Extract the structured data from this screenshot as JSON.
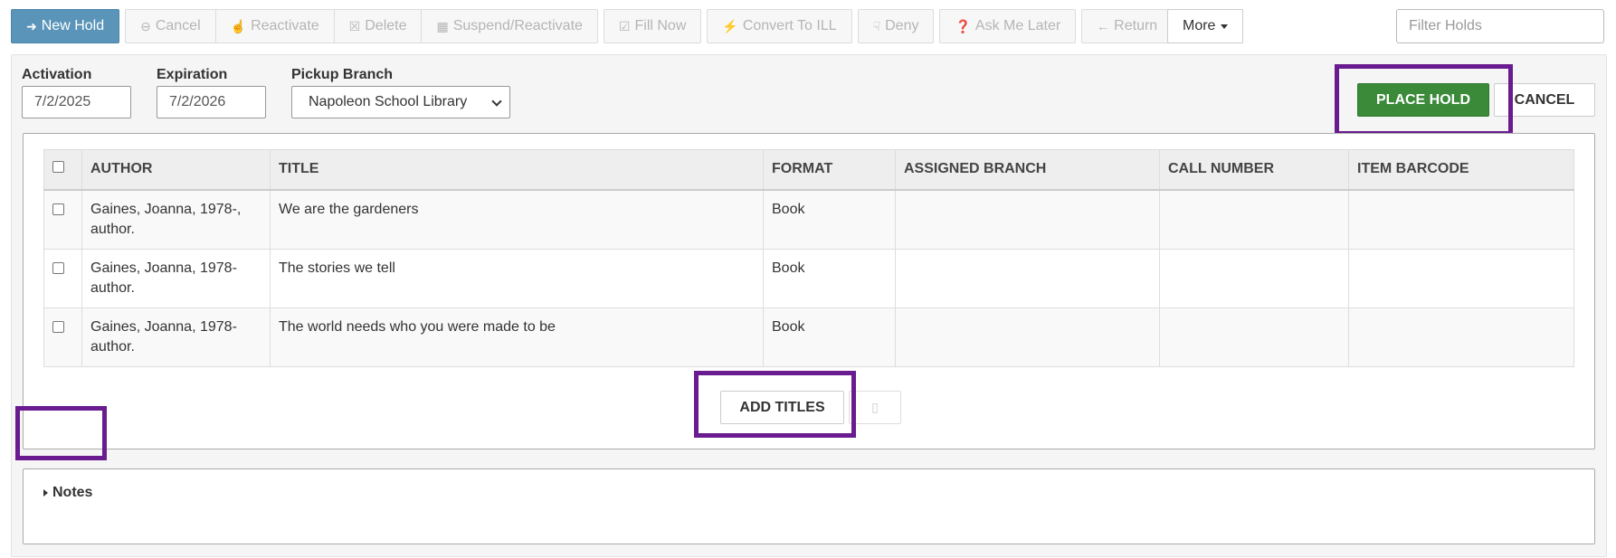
{
  "toolbar": {
    "new_hold": "New Hold",
    "cancel": "Cancel",
    "reactivate": "Reactivate",
    "delete": "Delete",
    "suspend_reactivate": "Suspend/Reactivate",
    "fill_now": "Fill Now",
    "convert_to_ill": "Convert To ILL",
    "deny": "Deny",
    "ask_me_later": "Ask Me Later",
    "return": "Return",
    "more": "More",
    "filter_placeholder": "Filter Holds"
  },
  "form": {
    "activation_label": "Activation",
    "activation_value": "7/2/2025",
    "expiration_label": "Expiration",
    "expiration_value": "7/2/2026",
    "pickup_label": "Pickup Branch",
    "pickup_value": "Napoleon School Library",
    "place_hold": "PLACE HOLD",
    "cancel": "CANCEL"
  },
  "table": {
    "headers": [
      "AUTHOR",
      "TITLE",
      "FORMAT",
      "ASSIGNED BRANCH",
      "CALL NUMBER",
      "ITEM BARCODE"
    ],
    "rows": [
      {
        "author": "Gaines, Joanna, 1978-, author.",
        "title": "We are the gardeners",
        "format": "Book",
        "branch": "",
        "call_number": "",
        "barcode": ""
      },
      {
        "author": "Gaines, Joanna, 1978- author.",
        "title": "The stories we tell",
        "format": "Book",
        "branch": "",
        "call_number": "",
        "barcode": ""
      },
      {
        "author": "Gaines, Joanna, 1978- author.",
        "title": "The world needs who you were made to be",
        "format": "Book",
        "branch": "",
        "call_number": "",
        "barcode": ""
      }
    ],
    "add_titles": "ADD TITLES"
  },
  "notes": {
    "label": "Notes"
  },
  "colors": {
    "primary": "#5a95b9",
    "success": "#3a8a3a",
    "highlight": "#6a1b8f"
  }
}
